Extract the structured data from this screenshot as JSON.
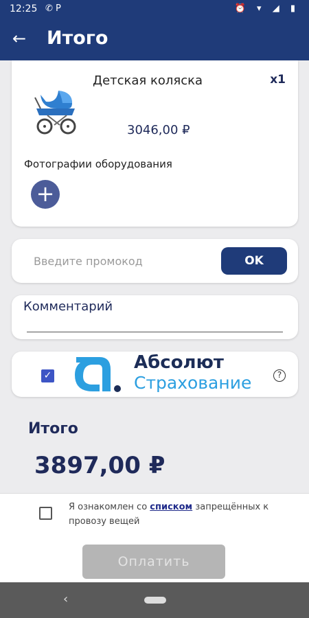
{
  "status_bar": {
    "time": "12:25",
    "left_icons": "✆ P",
    "right_icons": "⏰ ▾ ◢ ▮",
    "icon_names": [
      "whatsapp-icon",
      "parking-icon",
      "alarm-icon",
      "wifi-icon",
      "signal-icon",
      "battery-icon"
    ]
  },
  "app_bar": {
    "back_icon": "←",
    "title": "Итого"
  },
  "product": {
    "name": "Детская коляска",
    "quantity": "x1",
    "price": "3046,00 ₽",
    "photos_label": "Фотографии оборудования",
    "add_icon": "+",
    "image_icon": "stroller-icon"
  },
  "promo": {
    "placeholder": "Введите промокод",
    "value": "",
    "button_label": "OK"
  },
  "comment": {
    "label": "Комментарий"
  },
  "insurance": {
    "checked": true,
    "check_mark": "✓",
    "name_line1": "Абсолют",
    "name_line2": "Страхование",
    "help_icon": "?"
  },
  "total": {
    "label": "Итого",
    "value": "3897,00 ₽"
  },
  "agreement": {
    "checked": false,
    "text_before": "Я ознакомлен со ",
    "link_text": "списком",
    "text_after": " запрещённых к провозу вещей"
  },
  "pay_button": {
    "label": "Оплатить",
    "enabled": false
  },
  "nav_bar": {
    "back_glyph": "‹"
  },
  "colors": {
    "primary": "#1f3b79",
    "background": "#ececee",
    "insurance_dark": "#1c2d57",
    "insurance_light": "#2c9fe0",
    "disabled_button": "#b5b5b5",
    "nav_bar": "#5a5a5a"
  }
}
